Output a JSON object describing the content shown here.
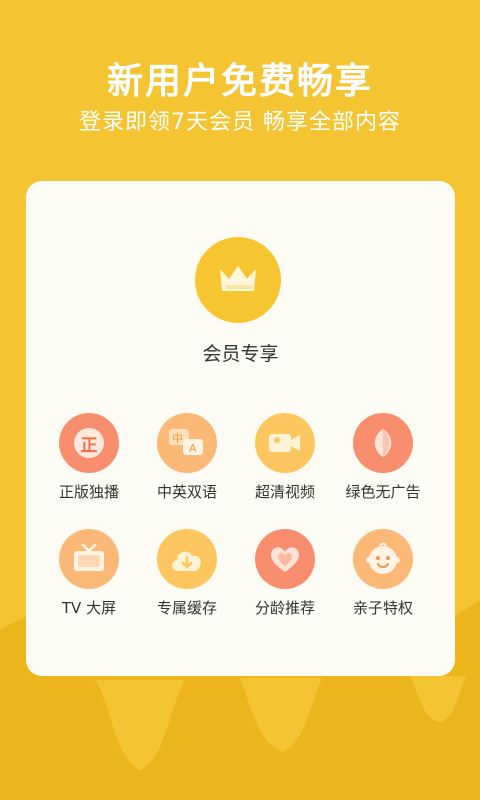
{
  "header": {
    "title": "新用户免费畅享",
    "subtitle": "登录即领7天会员 畅享全部内容"
  },
  "member": {
    "label": "会员专享",
    "icon": "crown-icon"
  },
  "benefits": [
    {
      "label": "正版独播",
      "icon": "genuine-icon",
      "color": "#F98E6E",
      "glyph": "正"
    },
    {
      "label": "中英双语",
      "icon": "bilingual-icon",
      "color": "#FBB877",
      "glyph": "中A"
    },
    {
      "label": "超清视频",
      "icon": "video-camera-icon",
      "color": "#FDC65E"
    },
    {
      "label": "绿色无广告",
      "icon": "leaf-icon",
      "color": "#F98E6E"
    },
    {
      "label": "TV 大屏",
      "icon": "tv-icon",
      "color": "#FBB877"
    },
    {
      "label": "专属缓存",
      "icon": "download-cloud-icon",
      "color": "#FDC65E"
    },
    {
      "label": "分龄推荐",
      "icon": "heart-icon",
      "color": "#F98E6E"
    },
    {
      "label": "亲子特权",
      "icon": "baby-face-icon",
      "color": "#FBB877"
    }
  ],
  "colors": {
    "background": "#F5C432",
    "card": "#FCFCF5",
    "crown_circle": "#F7C531"
  }
}
